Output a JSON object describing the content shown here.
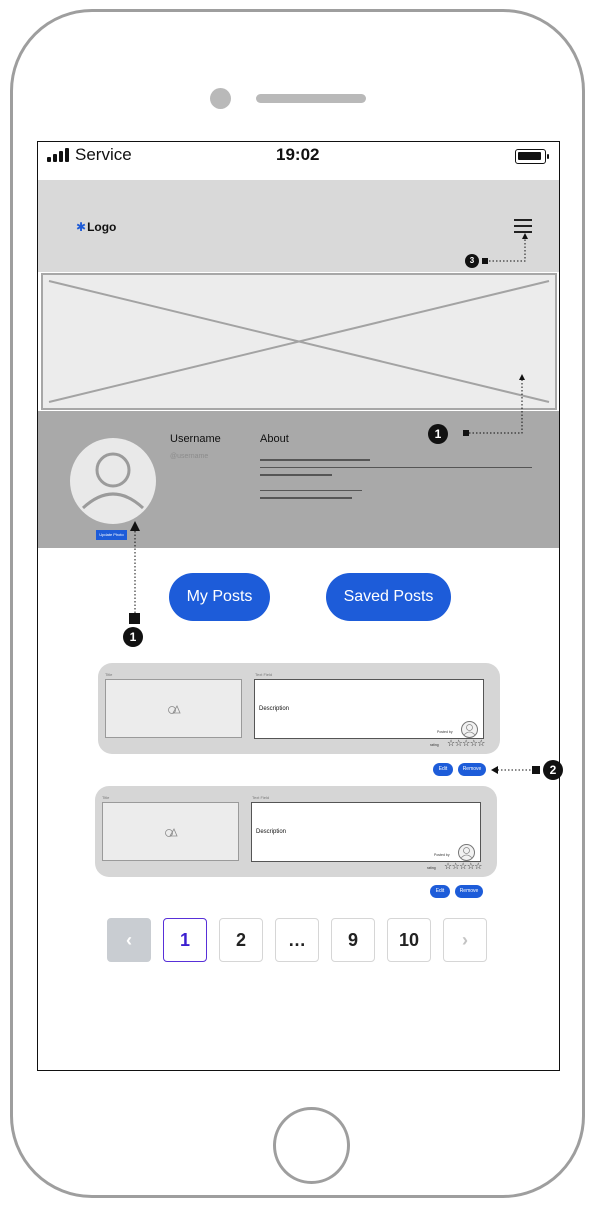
{
  "status_bar": {
    "carrier": "Service",
    "time": "19:02"
  },
  "header": {
    "logo_text": "Logo"
  },
  "profile": {
    "username": "Username",
    "handle": "@username",
    "about_title": "About",
    "update_photo_label": "Update Photo"
  },
  "tabs": {
    "my_posts": "My Posts",
    "saved_posts": "Saved Posts"
  },
  "posts": [
    {
      "title_label": "Title",
      "text_label": "Text Field",
      "description": "Description",
      "by_label": "Posted by",
      "rating_label": "rating",
      "rating_stars": "☆☆☆☆☆",
      "edit": "Edit",
      "remove": "Remove"
    },
    {
      "title_label": "Title",
      "text_label": "Text Field",
      "description": "Description",
      "by_label": "Posted by",
      "rating_label": "rating",
      "rating_stars": "☆☆☆☆☆",
      "edit": "Edit",
      "remove": "Remove"
    }
  ],
  "pagination": {
    "prev": "‹",
    "pages": [
      "1",
      "2",
      "…",
      "9",
      "10"
    ],
    "next": "›",
    "current": "1"
  },
  "annotations": {
    "m1": "1",
    "m2": "1",
    "m3": "2",
    "m4": "3"
  },
  "colors": {
    "accent": "#1d5cd9",
    "header_bg": "#d9d9d9",
    "profile_bg": "#a9a9a9",
    "active_page": "#3c1fd0"
  }
}
